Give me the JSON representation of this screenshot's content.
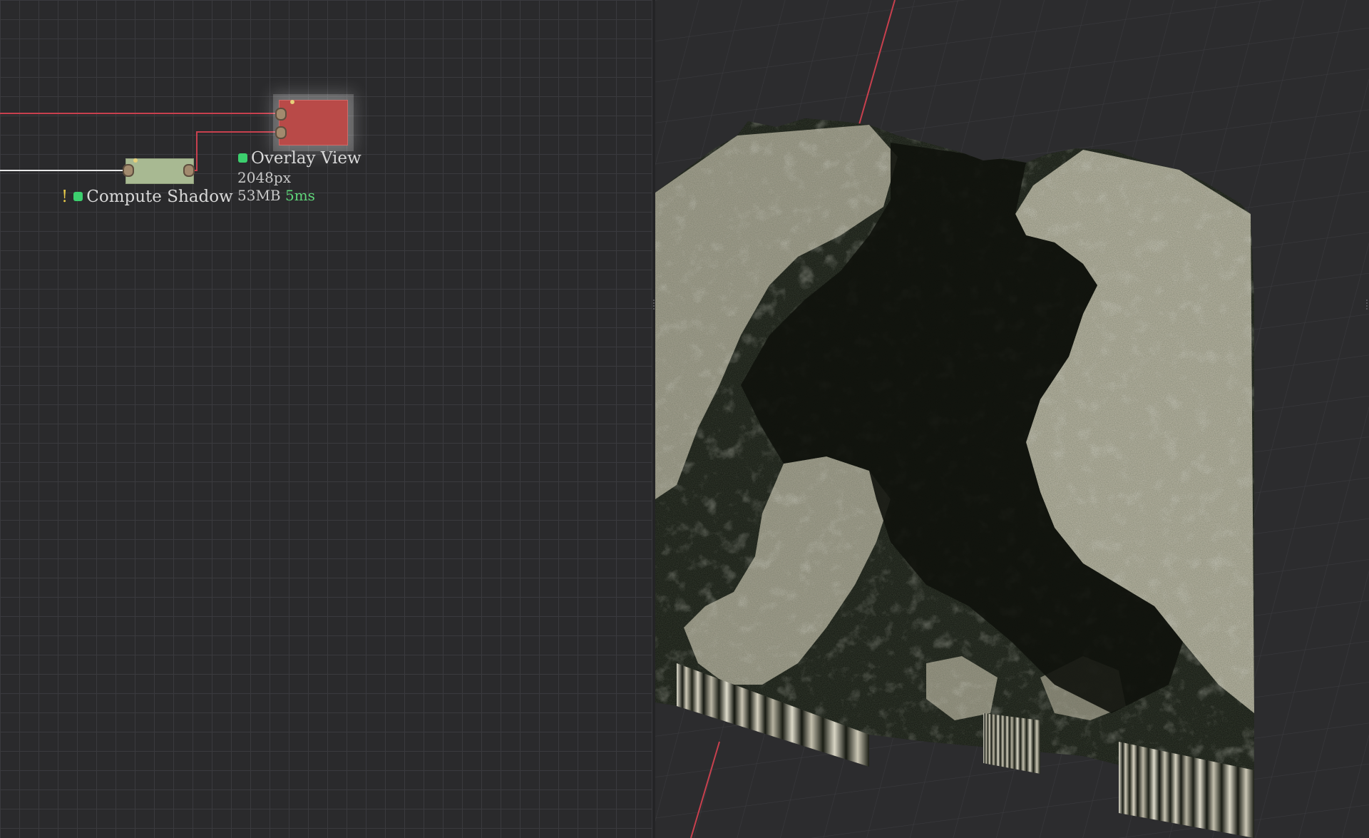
{
  "graph": {
    "nodes": [
      {
        "id": "overlay-view",
        "title": "Overlay View",
        "resolution": "2048px",
        "memory": "53MB",
        "time": "5ms",
        "color": "#b94a48",
        "selected": true
      },
      {
        "id": "compute-shadow",
        "title": "Compute Shadow",
        "warning": "!",
        "color": "#a8b992"
      }
    ],
    "status_color": "#3ccf6e",
    "wire_color": "#c8404e"
  },
  "viewport": {
    "axis_color": "#c8404e",
    "terrain_lit": "#d9d6c7",
    "terrain_shadow": "#0f130d"
  }
}
